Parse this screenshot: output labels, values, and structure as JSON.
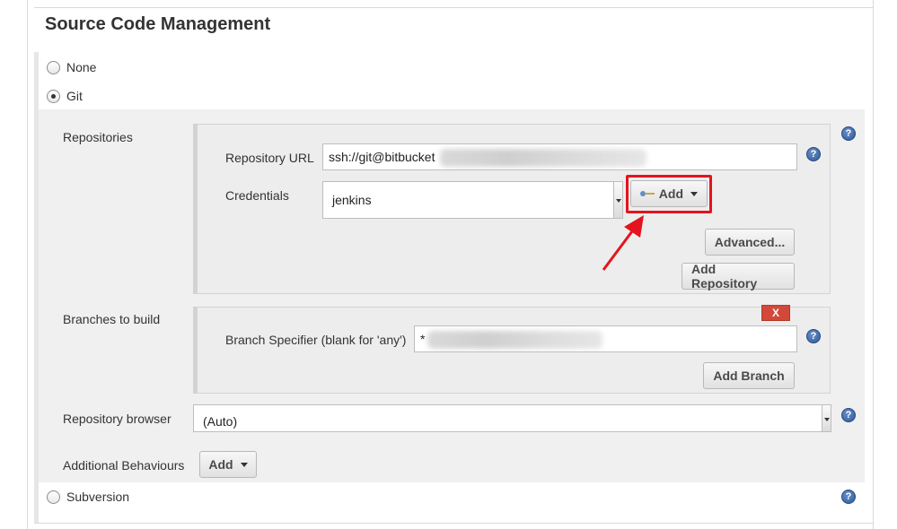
{
  "section": {
    "title": "Source Code Management"
  },
  "scm_options": {
    "none": "None",
    "git": "Git",
    "subversion": "Subversion",
    "selected": "Git"
  },
  "repositories": {
    "label": "Repositories",
    "url_label": "Repository URL",
    "url_value": "ssh://git@bitbucket",
    "credentials_label": "Credentials",
    "credentials_value": "jenkins",
    "add_button": "Add",
    "advanced_button": "Advanced...",
    "add_repository_button": "Add Repository"
  },
  "branches": {
    "label": "Branches to build",
    "specifier_label": "Branch Specifier (blank for 'any')",
    "specifier_value": "*",
    "delete_button": "X",
    "add_branch_button": "Add Branch"
  },
  "repo_browser": {
    "label": "Repository browser",
    "value": "(Auto)"
  },
  "additional_behaviours": {
    "label": "Additional Behaviours",
    "add_button": "Add"
  },
  "help_glyph": "?",
  "colors": {
    "highlight": "#e3141e",
    "help_icon": "#2f5b9a",
    "delete_button": "#d24939"
  },
  "icons": [
    "radio-icon",
    "help-icon",
    "key-icon",
    "caret-down-icon",
    "arrow-icon"
  ]
}
